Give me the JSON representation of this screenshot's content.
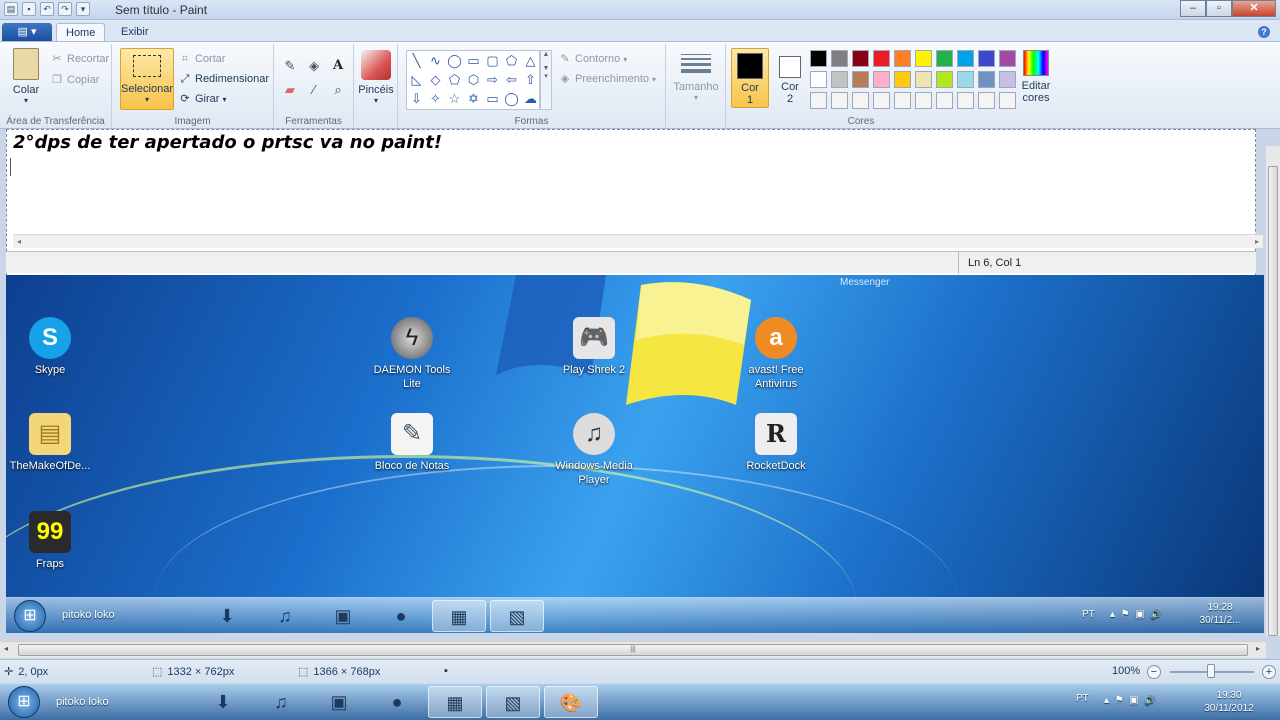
{
  "window": {
    "title": "Sem título - Paint",
    "quick_access": [
      "save",
      "undo",
      "redo",
      "customize"
    ],
    "controls": {
      "minimize": "–",
      "maximize": "▫",
      "close": "✕"
    }
  },
  "tabs": {
    "home": "Home",
    "view": "Exibir"
  },
  "ribbon": {
    "clipboard": {
      "paste": "Colar",
      "cut": "Recortar",
      "copy": "Copiar",
      "label": "Área de Transferência"
    },
    "image": {
      "select": "Selecionar",
      "crop": "Cortar",
      "resize": "Redimensionar",
      "rotate": "Girar",
      "label": "Imagem"
    },
    "tools": {
      "label": "Ferramentas"
    },
    "brushes": {
      "label": "Pincéis"
    },
    "shapes": {
      "outline": "Contorno",
      "fill": "Preenchimento",
      "label": "Formas"
    },
    "size": {
      "label": "Tamanho"
    },
    "colors": {
      "color1_label": "Cor",
      "color1_num": "1",
      "color2_label": "Cor",
      "color2_num": "2",
      "edit_label_1": "Editar",
      "edit_label_2": "cores",
      "label": "Cores",
      "color1": "#000000",
      "color2": "#ffffff",
      "palette": [
        "#000000",
        "#7f7f7f",
        "#880015",
        "#ed1c24",
        "#ff7f27",
        "#fff200",
        "#22b14c",
        "#00a2e8",
        "#3f48cc",
        "#a349a4",
        "#ffffff",
        "#c3c3c3",
        "#b97a57",
        "#ffaec9",
        "#ffc90e",
        "#efe4b0",
        "#b5e61d",
        "#99d9ea",
        "#7092be",
        "#c8bfe7",
        "#f4f4f4",
        "#f4f4f4",
        "#f4f4f4",
        "#f4f4f4",
        "#f4f4f4",
        "#f4f4f4",
        "#f4f4f4",
        "#f4f4f4",
        "#f4f4f4",
        "#f4f4f4"
      ]
    }
  },
  "canvas": {
    "note_text": "2°dps de ter apertado o prtsc va no paint!",
    "note_status": "Ln 6, Col 1",
    "desktop": {
      "messenger_label": "Messenger",
      "icons": [
        {
          "label": "Skype"
        },
        {
          "label": "DAEMON Tools Lite"
        },
        {
          "label": "Play Shrek 2"
        },
        {
          "label": "avast! Free Antivirus"
        },
        {
          "label": "TheMakeOfDe..."
        },
        {
          "label": "Bloco de Notas"
        },
        {
          "label": "Windows Media Player"
        },
        {
          "label": "RocketDock"
        },
        {
          "label": "Fraps"
        }
      ],
      "taskbar": {
        "user": "pitoko loko",
        "lang": "PT",
        "time": "19:28",
        "date": "30/11/2..."
      }
    }
  },
  "status": {
    "cursor_pos": "2, 0px",
    "selection_size": "1332 × 762px",
    "image_size": "1366 × 768px",
    "zoom": "100%"
  },
  "os_taskbar": {
    "user": "pitoko loko",
    "lang": "PT",
    "time": "19:30",
    "date": "30/11/2012"
  }
}
